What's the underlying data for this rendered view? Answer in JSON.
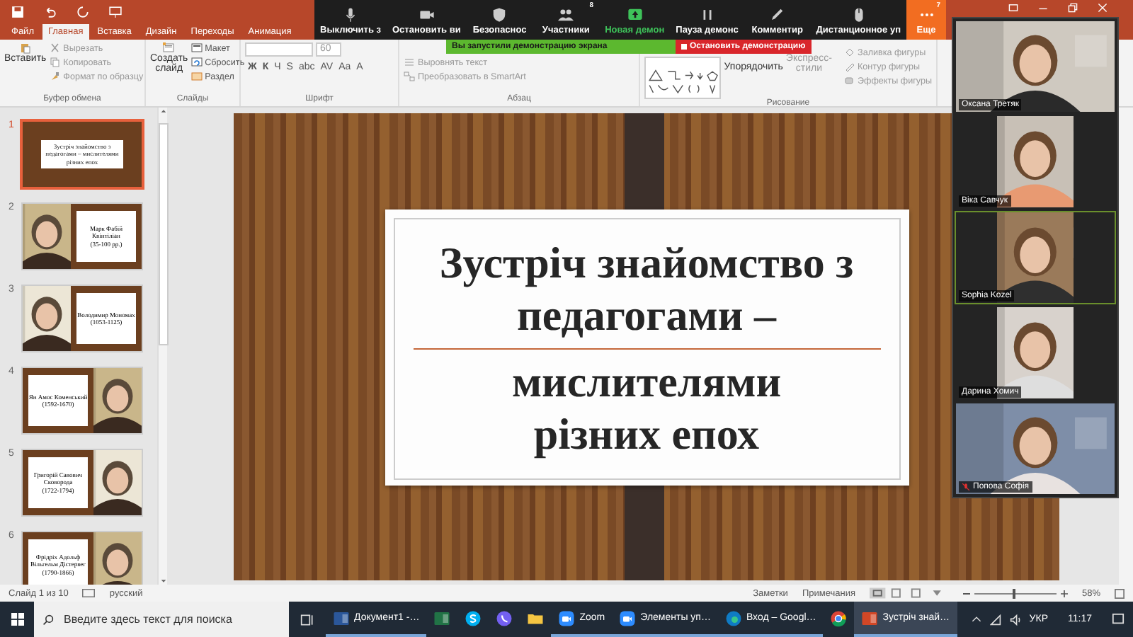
{
  "tabs": [
    {
      "label": "Файл",
      "selected": false
    },
    {
      "label": "Главная",
      "selected": true
    },
    {
      "label": "Вставка",
      "selected": false
    },
    {
      "label": "Дизайн",
      "selected": false
    },
    {
      "label": "Переходы",
      "selected": false
    },
    {
      "label": "Анимация",
      "selected": false
    }
  ],
  "ribbon": {
    "clipboard": {
      "label": "Буфер обмена",
      "big": "Вставить",
      "items": [
        "Вырезать",
        "Копировать",
        "Формат по образцу"
      ]
    },
    "slides": {
      "label": "Слайды",
      "big": "Создать слайд",
      "items": [
        "Макет",
        "Сбросить",
        "Раздел"
      ]
    },
    "font": {
      "label": "Шрифт",
      "size": "60",
      "format_buttons": [
        "Ж",
        "К",
        "Ч",
        "S",
        "abc",
        "AV",
        "Aa",
        "A"
      ]
    },
    "paragraph": {
      "label": "Абзац",
      "items": [
        "Выровнять текст",
        "Преобразовать в SmartArt"
      ]
    },
    "drawing": {
      "label": "Рисование",
      "arrange": "Упорядочить",
      "styles": "Экспресс-стили",
      "items": [
        "Заливка фигуры",
        "Контур фигуры",
        "Эффекты фигуры"
      ]
    }
  },
  "zoom_toolbar": [
    {
      "label": "Выключить з",
      "kind": "mic",
      "highlighted": false
    },
    {
      "label": "Остановить ви",
      "kind": "video",
      "highlighted": false
    },
    {
      "label": "Безопаснос",
      "kind": "shield",
      "highlighted": false
    },
    {
      "label": "Участники",
      "kind": "people",
      "badge": "8",
      "highlighted": false
    },
    {
      "label": "Новая демон",
      "kind": "share",
      "highlighted": true
    },
    {
      "label": "Пауза демонс",
      "kind": "pause",
      "highlighted": false
    },
    {
      "label": "Комментир",
      "kind": "pen",
      "highlighted": false
    },
    {
      "label": "Дистанционное уп",
      "kind": "mouse",
      "highlighted": false
    },
    {
      "label": "Еще",
      "kind": "more",
      "badge": "7",
      "highlighted": false
    }
  ],
  "share_banner": {
    "message": "Вы запустили демонстрацию экрана",
    "stop": "Остановить демонстрацию"
  },
  "participants": [
    {
      "name": "Оксана Третяк",
      "active_speaker": false,
      "muted": false
    },
    {
      "name": "Віка Савчук",
      "active_speaker": false,
      "muted": false
    },
    {
      "name": "Sophia Kozel",
      "active_speaker": true,
      "muted": false
    },
    {
      "name": "Дарина Хомич",
      "active_speaker": false,
      "muted": false
    },
    {
      "name": "Попова Софія",
      "active_speaker": false,
      "muted": true
    }
  ],
  "thumbnails": [
    {
      "number": "1",
      "selected": true,
      "kind": "title",
      "text": "Зустріч знайомство з педагогами – мислителями різних епох"
    },
    {
      "number": "2",
      "selected": false,
      "kind": "portrait",
      "picture_first": true,
      "name": "Марк Фабій Квінтіліан",
      "dates": "(35-100 рр.)"
    },
    {
      "number": "3",
      "selected": false,
      "kind": "portrait",
      "picture_first": true,
      "name": "Володимир Мономах",
      "dates": "(1053-1125)"
    },
    {
      "number": "4",
      "selected": false,
      "kind": "portrait",
      "picture_first": false,
      "name": "Ян Амос Коменський",
      "dates": "(1592-1670)"
    },
    {
      "number": "5",
      "selected": false,
      "kind": "portrait",
      "picture_first": false,
      "name": "Григорій Савович Сковорода",
      "dates": "(1722-1794)"
    },
    {
      "number": "6",
      "selected": false,
      "kind": "portrait",
      "picture_first": false,
      "name": "Фрідріх Адольф Вільгельм Дістервег",
      "dates": "(1790-1866)"
    }
  ],
  "slide": {
    "title_top": "Зустріч знайомство з педагогами –",
    "title_bottom": "мислителями різних епох"
  },
  "status_bar": {
    "slide": "Слайд 1 из 10",
    "language": "русский",
    "notes": "Заметки",
    "comments": "Примечания",
    "zoom": "58%",
    "level": 0.47
  },
  "taskbar": {
    "search": {
      "placeholder": "Введите здесь текст для поиска"
    },
    "apps": [
      {
        "kind": "word",
        "label": "Документ1 -…",
        "selected": false
      },
      {
        "kind": "excel",
        "selected": false
      },
      {
        "kind": "skype",
        "selected": false
      },
      {
        "kind": "viber",
        "selected": false
      },
      {
        "kind": "folder",
        "selected": false
      },
      {
        "kind": "zoom",
        "label": "Zoom",
        "selected": false
      },
      {
        "kind": "zoom",
        "label": "Элементы уп…",
        "selected": false
      },
      {
        "kind": "edge",
        "label": "Вход – Googl…",
        "selected": false
      },
      {
        "kind": "chrome",
        "selected": false
      },
      {
        "kind": "powerpoint",
        "label": "Зустріч знай…",
        "selected": true
      }
    ],
    "language": "УКР",
    "time": "11:17"
  }
}
